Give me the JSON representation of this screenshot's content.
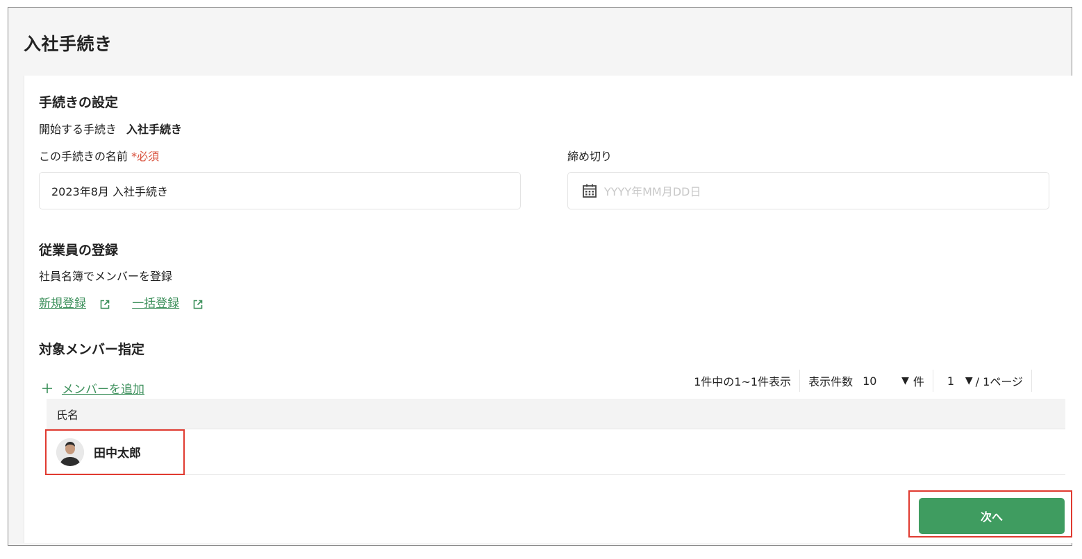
{
  "page": {
    "title": "入社手続き"
  },
  "settings": {
    "title": "手続きの設定",
    "start_label": "開始する手続き",
    "start_value": "入社手続き",
    "name_label": "この手続きの名前",
    "required_mark": "*必須",
    "name_value": "2023年8月 入社手続き",
    "deadline_label": "締め切り",
    "deadline_placeholder": "YYYY年MM月DD日"
  },
  "employees": {
    "title": "従業員の登録",
    "description": "社員名簿でメンバーを登録",
    "links": [
      {
        "label": "新規登録"
      },
      {
        "label": "一括登録"
      }
    ]
  },
  "members": {
    "title": "対象メンバー指定",
    "add_label": "メンバーを追加",
    "pager": {
      "summary": "1件中の1~1件表示",
      "per_page_label": "表示件数",
      "per_page_value": "10",
      "per_page_unit": "件",
      "page_value": "1",
      "page_total": "/ 1ページ"
    },
    "column_name": "氏名",
    "rows": [
      {
        "name": "田中太郎"
      }
    ]
  },
  "actions": {
    "next_label": "次へ"
  },
  "colors": {
    "accent": "#3f9c60",
    "link": "#3b8f5a",
    "required": "#d9533f",
    "highlight": "#e03a30"
  }
}
